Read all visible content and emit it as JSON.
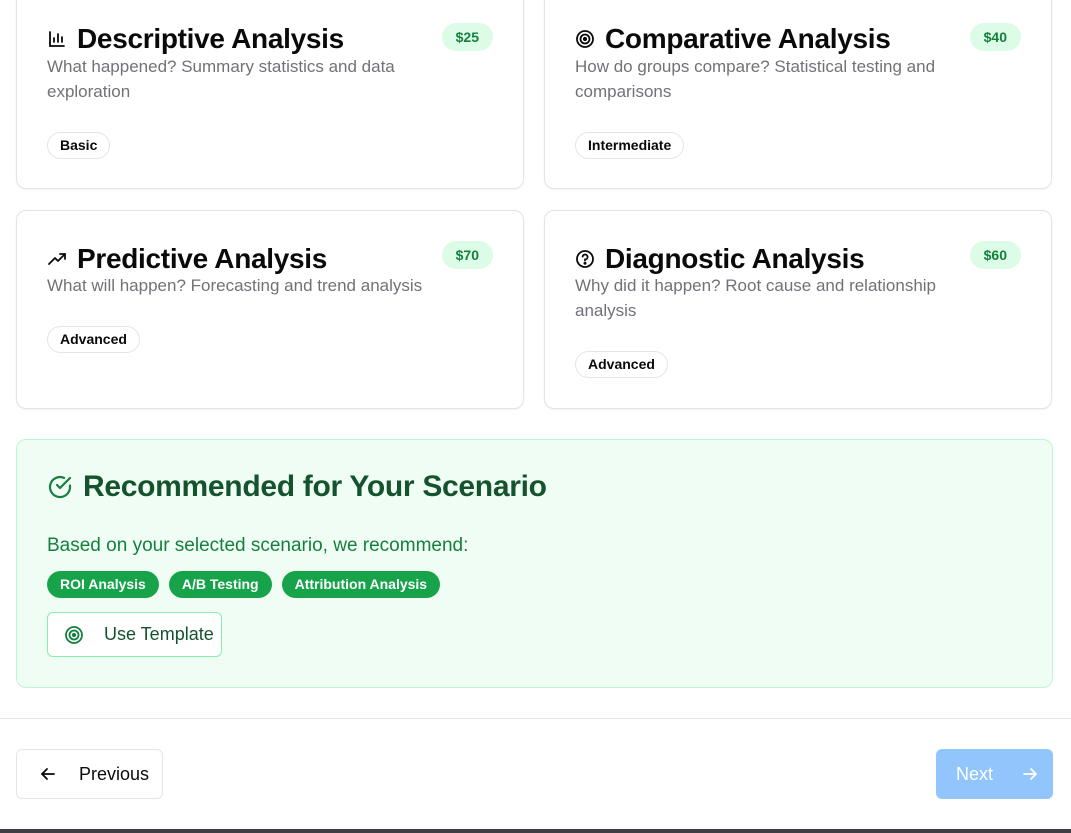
{
  "analysis_types": [
    {
      "icon": "bar-chart-icon",
      "title": "Descriptive Analysis",
      "price": "$25",
      "description": "What happened? Summary statistics and data exploration",
      "level": "Basic"
    },
    {
      "icon": "target-icon",
      "title": "Comparative Analysis",
      "price": "$40",
      "description": "How do groups compare? Statistical testing and comparisons",
      "level": "Intermediate"
    },
    {
      "icon": "trending-up-icon",
      "title": "Predictive Analysis",
      "price": "$70",
      "description": "What will happen? Forecasting and trend analysis",
      "level": "Advanced"
    },
    {
      "icon": "help-circle-icon",
      "title": "Diagnostic Analysis",
      "price": "$60",
      "description": "Why did it happen? Root cause and relationship analysis",
      "level": "Advanced"
    }
  ],
  "recommendation": {
    "icon": "check-circle-icon",
    "title": "Recommended for Your Scenario",
    "text": "Based on your selected scenario, we recommend:",
    "tags": [
      "ROI Analysis",
      "A/B Testing",
      "Attribution Analysis"
    ],
    "template_button": {
      "icon": "target-icon",
      "label": "Use Template"
    }
  },
  "navigation": {
    "previous_label": "Previous",
    "next_label": "Next",
    "next_disabled": true
  },
  "colors": {
    "price_badge_bg": "#dcfce7",
    "price_badge_text": "#15803d",
    "recommend_bg": "#f0fdf4",
    "recommend_title": "#14532d",
    "tag_bg": "#16a34a",
    "next_button_disabled": "#93c5fd"
  }
}
